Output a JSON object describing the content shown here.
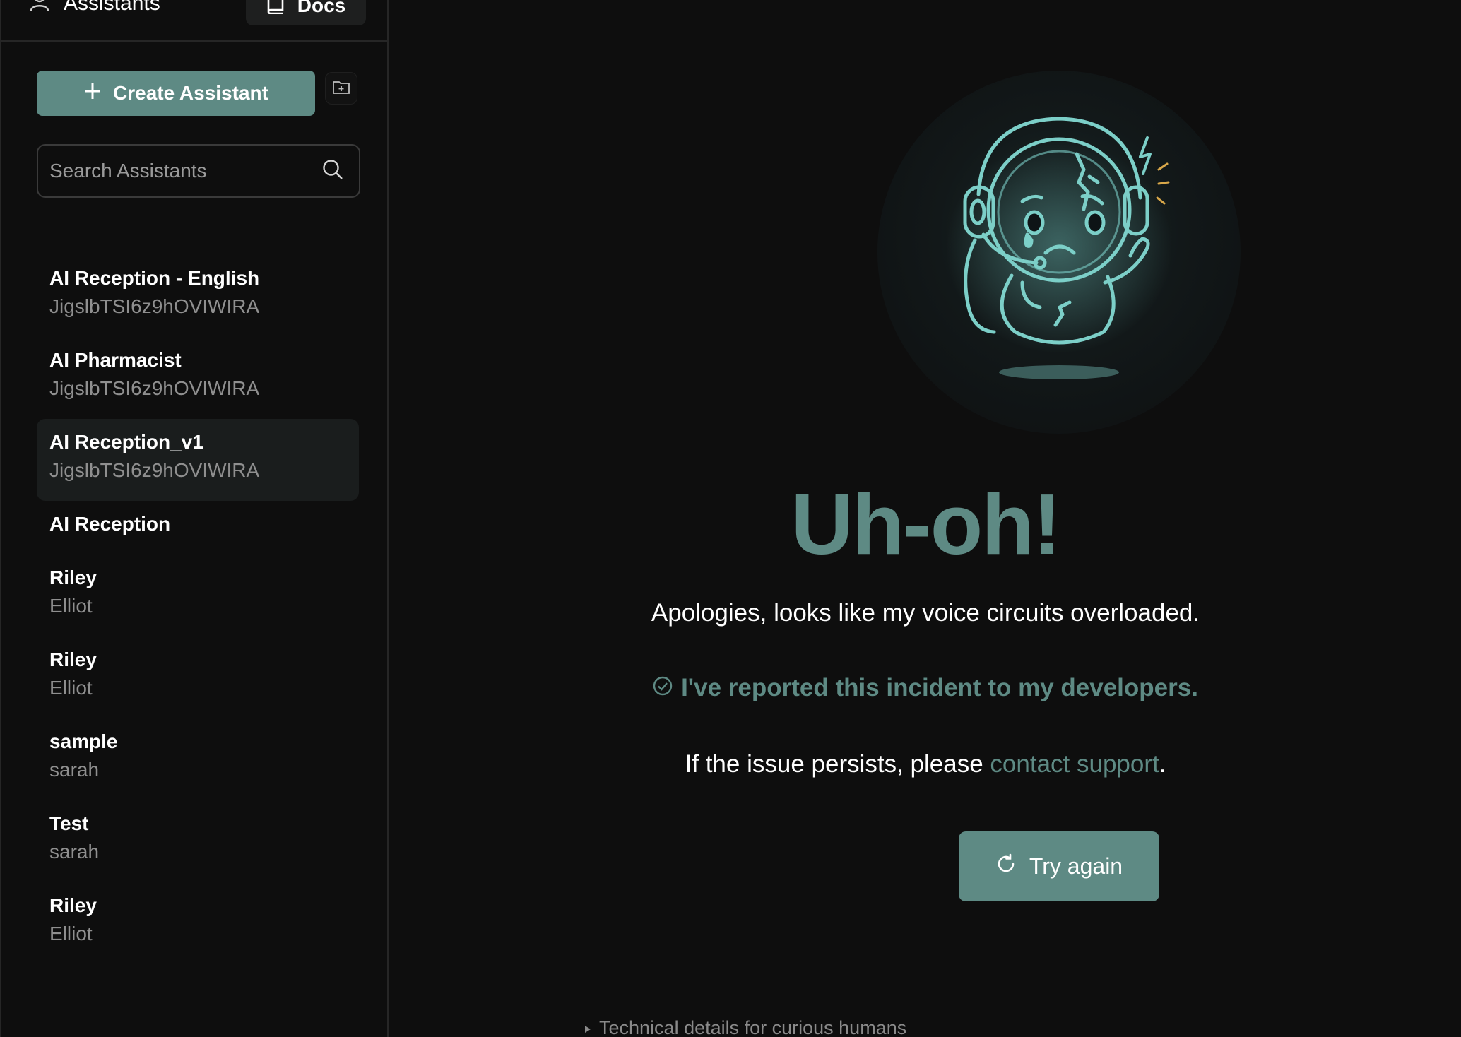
{
  "sidebar": {
    "tab_label": "Assistants",
    "docs_label": "Docs",
    "create_label": "Create Assistant",
    "search_placeholder": "Search Assistants",
    "items": [
      {
        "name": "AI Reception - English",
        "sub": "JigslbTSI6z9hOVIWIRA"
      },
      {
        "name": "AI Pharmacist",
        "sub": "JigslbTSI6z9hOVIWIRA"
      },
      {
        "name": "AI Reception_v1",
        "sub": "JigslbTSI6z9hOVIWIRA",
        "active": true
      },
      {
        "name": "AI Reception",
        "sub": ""
      },
      {
        "name": "Riley",
        "sub": "Elliot"
      },
      {
        "name": "Riley",
        "sub": "Elliot"
      },
      {
        "name": "sample",
        "sub": "sarah"
      },
      {
        "name": "Test",
        "sub": "sarah"
      },
      {
        "name": "Riley",
        "sub": "Elliot"
      }
    ]
  },
  "error": {
    "headline": "Uh-oh!",
    "apology": "Apologies, looks like my voice circuits overloaded.",
    "reported": "I've reported this incident to my developers.",
    "persist_prefix": "If the issue persists, please ",
    "support_link": "contact support",
    "persist_suffix": ".",
    "try_again_label": "Try again",
    "tech_details_label": "Technical details for curious humans"
  },
  "colors": {
    "accent": "#5e8a84",
    "background": "#0e0e0e",
    "active_item": "#1a1d1d",
    "mascot_glow": "#7ccfc8"
  },
  "icons": {
    "assistants": "user-icon",
    "docs": "book-icon",
    "create": "plus-icon",
    "folder": "folder-plus-icon",
    "search": "search-icon",
    "reported": "check-circle-icon",
    "try_again": "refresh-icon",
    "tech_details": "triangle-right-icon"
  }
}
